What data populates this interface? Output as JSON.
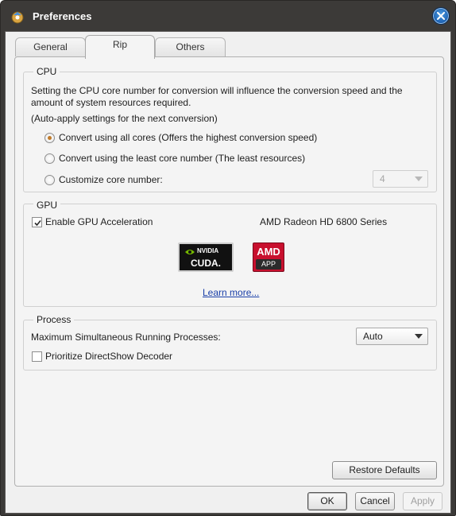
{
  "window": {
    "title": "Preferences",
    "icons": {
      "app": "app-icon",
      "close": "close-icon"
    }
  },
  "tabs": [
    {
      "label": "General",
      "selected": false
    },
    {
      "label": "Rip",
      "selected": true
    },
    {
      "label": "Others",
      "selected": false
    }
  ],
  "cpu": {
    "title": "CPU",
    "description": "Setting the CPU core number for conversion will influence the conversion speed and the amount of system resources required.",
    "description_line1": "Setting the CPU core number for conversion will influence the conversion speed and the",
    "description_line2": "amount of system resources required.",
    "note": "(Auto-apply settings for the next conversion)",
    "options": [
      {
        "label": "Convert using all cores (Offers the highest conversion speed)",
        "checked": true
      },
      {
        "label": "Convert using the least core number (The least resources)",
        "checked": false
      },
      {
        "label": "Customize core number:",
        "checked": false
      }
    ],
    "core_number": {
      "value": "4",
      "disabled": true
    }
  },
  "gpu": {
    "title": "GPU",
    "acceleration_label": "Enable GPU Acceleration",
    "acceleration_checked": true,
    "device_name": "AMD Radeon HD 6800 Series",
    "nvidia_logo": {
      "brand": "NVIDIA",
      "product": "CUDA."
    },
    "amd_logo": {
      "brand": "AMD",
      "product": "APP"
    },
    "learn_more": "Learn more..."
  },
  "process": {
    "title": "Process",
    "max_processes_label": "Maximum Simultaneous Running Processes:",
    "max_processes_value": "Auto",
    "directshow_label": "Prioritize DirectShow Decoder",
    "directshow_checked": false
  },
  "buttons": {
    "restore_defaults": "Restore Defaults",
    "ok": "OK",
    "cancel": "Cancel",
    "apply": "Apply",
    "apply_disabled": true
  },
  "colors": {
    "frame": "#3c3a38",
    "panel": "#f4f4f4",
    "link": "#1a3fa8",
    "radio_dot": "#c07a2a",
    "amd_red": "#c8102e"
  }
}
